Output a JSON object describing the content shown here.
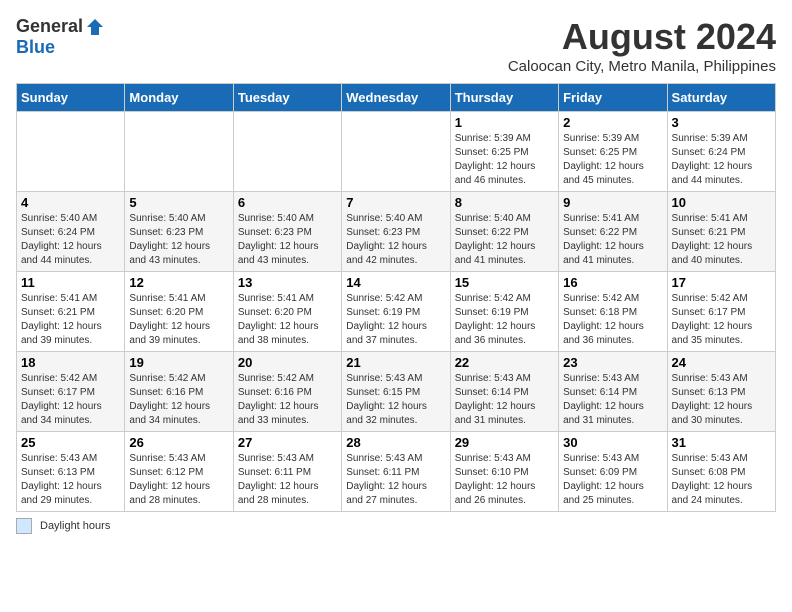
{
  "logo": {
    "general": "General",
    "blue": "Blue"
  },
  "title": "August 2024",
  "subtitle": "Caloocan City, Metro Manila, Philippines",
  "days_of_week": [
    "Sunday",
    "Monday",
    "Tuesday",
    "Wednesday",
    "Thursday",
    "Friday",
    "Saturday"
  ],
  "footer_label": "Daylight hours",
  "weeks": [
    [
      {
        "day": "",
        "info": ""
      },
      {
        "day": "",
        "info": ""
      },
      {
        "day": "",
        "info": ""
      },
      {
        "day": "",
        "info": ""
      },
      {
        "day": "1",
        "info": "Sunrise: 5:39 AM\nSunset: 6:25 PM\nDaylight: 12 hours\nand 46 minutes."
      },
      {
        "day": "2",
        "info": "Sunrise: 5:39 AM\nSunset: 6:25 PM\nDaylight: 12 hours\nand 45 minutes."
      },
      {
        "day": "3",
        "info": "Sunrise: 5:39 AM\nSunset: 6:24 PM\nDaylight: 12 hours\nand 44 minutes."
      }
    ],
    [
      {
        "day": "4",
        "info": "Sunrise: 5:40 AM\nSunset: 6:24 PM\nDaylight: 12 hours\nand 44 minutes."
      },
      {
        "day": "5",
        "info": "Sunrise: 5:40 AM\nSunset: 6:23 PM\nDaylight: 12 hours\nand 43 minutes."
      },
      {
        "day": "6",
        "info": "Sunrise: 5:40 AM\nSunset: 6:23 PM\nDaylight: 12 hours\nand 43 minutes."
      },
      {
        "day": "7",
        "info": "Sunrise: 5:40 AM\nSunset: 6:23 PM\nDaylight: 12 hours\nand 42 minutes."
      },
      {
        "day": "8",
        "info": "Sunrise: 5:40 AM\nSunset: 6:22 PM\nDaylight: 12 hours\nand 41 minutes."
      },
      {
        "day": "9",
        "info": "Sunrise: 5:41 AM\nSunset: 6:22 PM\nDaylight: 12 hours\nand 41 minutes."
      },
      {
        "day": "10",
        "info": "Sunrise: 5:41 AM\nSunset: 6:21 PM\nDaylight: 12 hours\nand 40 minutes."
      }
    ],
    [
      {
        "day": "11",
        "info": "Sunrise: 5:41 AM\nSunset: 6:21 PM\nDaylight: 12 hours\nand 39 minutes."
      },
      {
        "day": "12",
        "info": "Sunrise: 5:41 AM\nSunset: 6:20 PM\nDaylight: 12 hours\nand 39 minutes."
      },
      {
        "day": "13",
        "info": "Sunrise: 5:41 AM\nSunset: 6:20 PM\nDaylight: 12 hours\nand 38 minutes."
      },
      {
        "day": "14",
        "info": "Sunrise: 5:42 AM\nSunset: 6:19 PM\nDaylight: 12 hours\nand 37 minutes."
      },
      {
        "day": "15",
        "info": "Sunrise: 5:42 AM\nSunset: 6:19 PM\nDaylight: 12 hours\nand 36 minutes."
      },
      {
        "day": "16",
        "info": "Sunrise: 5:42 AM\nSunset: 6:18 PM\nDaylight: 12 hours\nand 36 minutes."
      },
      {
        "day": "17",
        "info": "Sunrise: 5:42 AM\nSunset: 6:17 PM\nDaylight: 12 hours\nand 35 minutes."
      }
    ],
    [
      {
        "day": "18",
        "info": "Sunrise: 5:42 AM\nSunset: 6:17 PM\nDaylight: 12 hours\nand 34 minutes."
      },
      {
        "day": "19",
        "info": "Sunrise: 5:42 AM\nSunset: 6:16 PM\nDaylight: 12 hours\nand 34 minutes."
      },
      {
        "day": "20",
        "info": "Sunrise: 5:42 AM\nSunset: 6:16 PM\nDaylight: 12 hours\nand 33 minutes."
      },
      {
        "day": "21",
        "info": "Sunrise: 5:43 AM\nSunset: 6:15 PM\nDaylight: 12 hours\nand 32 minutes."
      },
      {
        "day": "22",
        "info": "Sunrise: 5:43 AM\nSunset: 6:14 PM\nDaylight: 12 hours\nand 31 minutes."
      },
      {
        "day": "23",
        "info": "Sunrise: 5:43 AM\nSunset: 6:14 PM\nDaylight: 12 hours\nand 31 minutes."
      },
      {
        "day": "24",
        "info": "Sunrise: 5:43 AM\nSunset: 6:13 PM\nDaylight: 12 hours\nand 30 minutes."
      }
    ],
    [
      {
        "day": "25",
        "info": "Sunrise: 5:43 AM\nSunset: 6:13 PM\nDaylight: 12 hours\nand 29 minutes."
      },
      {
        "day": "26",
        "info": "Sunrise: 5:43 AM\nSunset: 6:12 PM\nDaylight: 12 hours\nand 28 minutes."
      },
      {
        "day": "27",
        "info": "Sunrise: 5:43 AM\nSunset: 6:11 PM\nDaylight: 12 hours\nand 28 minutes."
      },
      {
        "day": "28",
        "info": "Sunrise: 5:43 AM\nSunset: 6:11 PM\nDaylight: 12 hours\nand 27 minutes."
      },
      {
        "day": "29",
        "info": "Sunrise: 5:43 AM\nSunset: 6:10 PM\nDaylight: 12 hours\nand 26 minutes."
      },
      {
        "day": "30",
        "info": "Sunrise: 5:43 AM\nSunset: 6:09 PM\nDaylight: 12 hours\nand 25 minutes."
      },
      {
        "day": "31",
        "info": "Sunrise: 5:43 AM\nSunset: 6:08 PM\nDaylight: 12 hours\nand 24 minutes."
      }
    ]
  ]
}
